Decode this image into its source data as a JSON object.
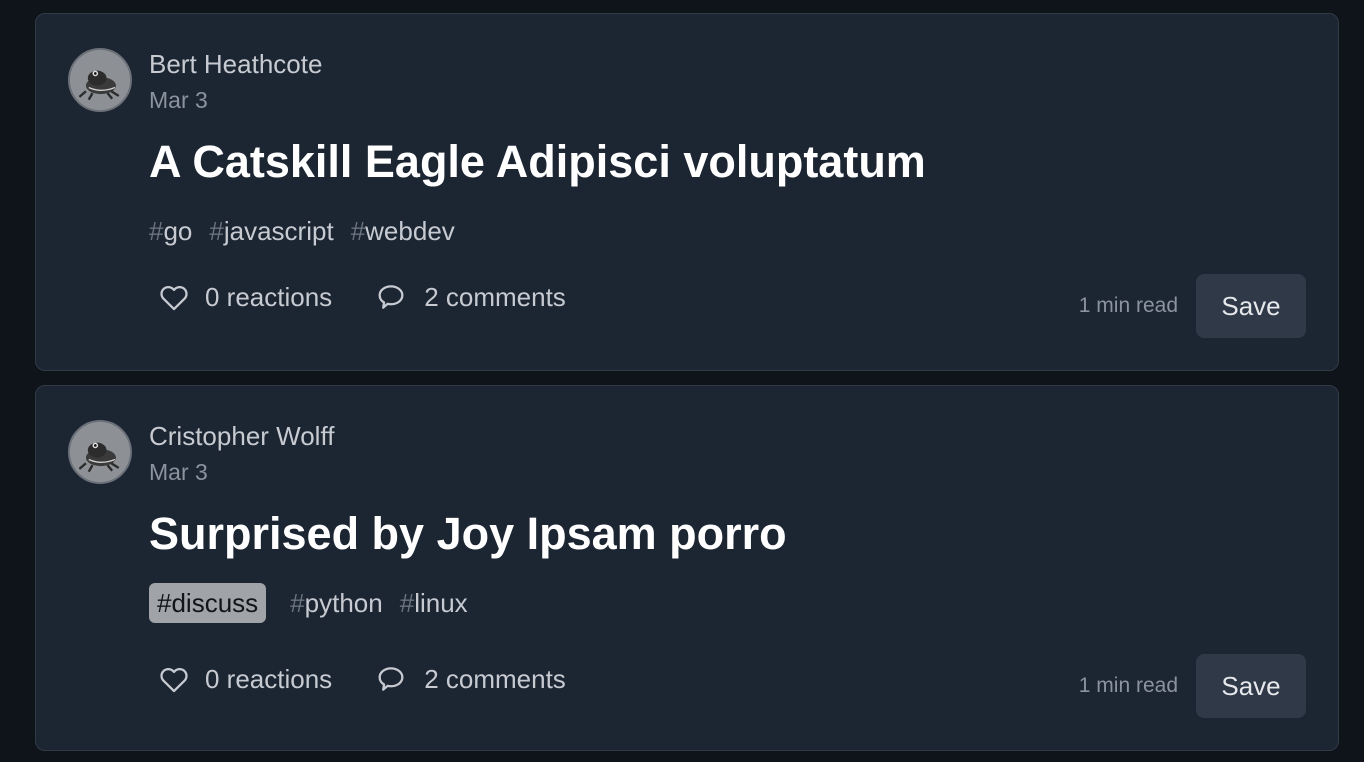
{
  "posts": [
    {
      "author": "Bert Heathcote",
      "date": "Mar 3",
      "title": "A Catskill Eagle Adipisci voluptatum",
      "tags": [
        "go",
        "javascript",
        "webdev"
      ],
      "active_tag": null,
      "reactions": "0 reactions",
      "comments": "2 comments",
      "read_time": "1 min read",
      "save_label": "Save"
    },
    {
      "author": "Cristopher Wolff",
      "date": "Mar 3",
      "title": "Surprised by Joy Ipsam porro",
      "tags": [
        "discuss",
        "python",
        "linux"
      ],
      "active_tag": "discuss",
      "reactions": "0 reactions",
      "comments": "2 comments",
      "read_time": "1 min read",
      "save_label": "Save"
    }
  ],
  "tag_prefix": "#",
  "icons": {
    "reactions": "heart-icon",
    "comments": "comment-bubble-icon",
    "avatar": "frog-avatar"
  },
  "colors": {
    "background": "#0f141b",
    "card": "#1c2532",
    "active_tag_bg": "#a0a3a8"
  }
}
